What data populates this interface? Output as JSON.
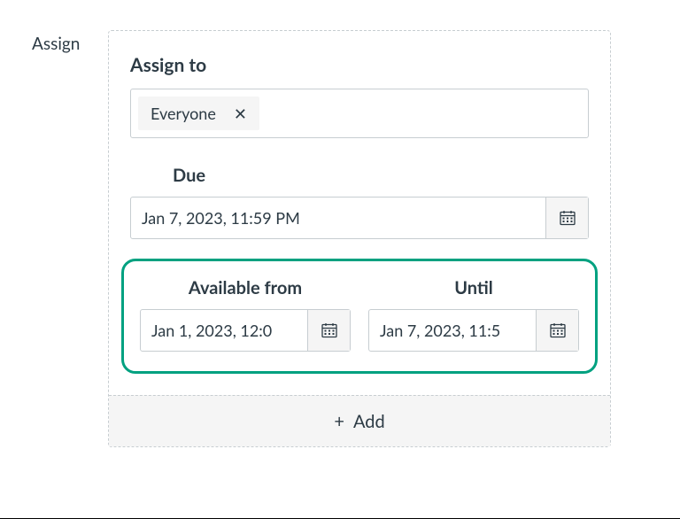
{
  "sideLabel": "Assign",
  "assignTo": {
    "title": "Assign to",
    "tokenLabel": "Everyone"
  },
  "due": {
    "label": "Due",
    "value": "Jan 7, 2023, 11:59 PM"
  },
  "availableFrom": {
    "label": "Available from",
    "value": "Jan 1, 2023, 12:0"
  },
  "until": {
    "label": "Until",
    "value": "Jan 7, 2023, 11:5"
  },
  "addLabel": "Add"
}
